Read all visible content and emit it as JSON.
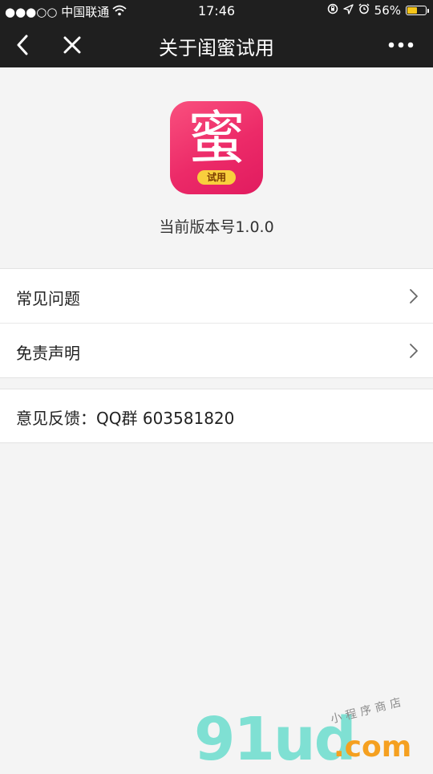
{
  "status_bar": {
    "carrier": "●●●○○ 中国联通",
    "time": "17:46",
    "battery_percent": "56%",
    "battery_level": 0.56,
    "battery_color": "#f5c518",
    "icons": [
      "signal-dots-icon",
      "wifi-icon",
      "orientation-lock-icon",
      "location-icon",
      "alarm-icon",
      "battery-icon"
    ]
  },
  "navbar": {
    "title": "关于闺蜜试用",
    "back_icon": "chevron-left-icon",
    "close_icon": "close-icon",
    "more_icon": "more-dots-icon",
    "background": "#1f1f1f"
  },
  "app": {
    "icon_char": "蜜",
    "icon_tag": "试用",
    "icon_colors": [
      "#f9507e",
      "#e11b5f"
    ],
    "version_text": "当前版本号1.0.0"
  },
  "menu": {
    "items": [
      {
        "label": "常见问题",
        "icon": "chevron-right-icon"
      },
      {
        "label": "免责声明",
        "icon": "chevron-right-icon"
      }
    ]
  },
  "feedback": {
    "text": "意见反馈：QQ群 603581820"
  },
  "watermark": {
    "logo": "91ud",
    "domain": ".com",
    "subtitle": "小程序商店",
    "colors": [
      "#7fe0d3",
      "#f5a020"
    ]
  }
}
